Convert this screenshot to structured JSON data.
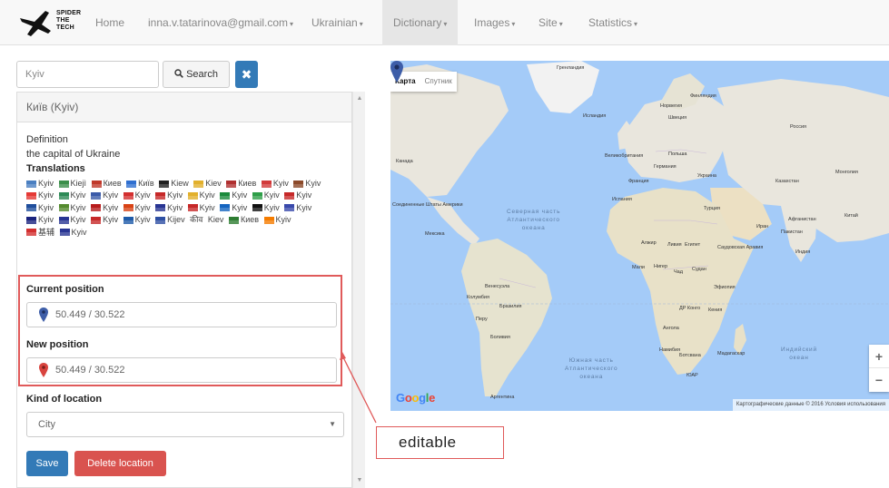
{
  "navbar": {
    "logo_text": "SPIDER\nTHE\nTECH",
    "items": [
      {
        "label": "Home",
        "caret": ""
      },
      {
        "label": "inna.v.tatarinova@gmail.com",
        "caret": "▾"
      },
      {
        "label": "Ukrainian",
        "caret": "▾"
      },
      {
        "label": "Dictionary",
        "caret": "▾"
      },
      {
        "label": "Images",
        "caret": "▾"
      },
      {
        "label": "Site",
        "caret": "▾"
      },
      {
        "label": "Statistics",
        "caret": "▾"
      }
    ]
  },
  "search": {
    "value": "Kyiv",
    "button_label": "Search",
    "clear_symbol": "✖"
  },
  "panel": {
    "heading": "Київ (Kyiv)",
    "definition_title": "Definition",
    "definition_text": "the capital of Ukraine",
    "translations_title": "Translations",
    "translations": [
      {
        "text": "Kyiv",
        "color": "#4a7fc1"
      },
      {
        "text": "Kiejì",
        "color": "#3b8f4a"
      },
      {
        "text": "Киев",
        "color": "#c0392b"
      },
      {
        "text": "Київ",
        "color": "#2f6fd0"
      },
      {
        "text": "Kiew",
        "color": "#222222"
      },
      {
        "text": "Kiev",
        "color": "#e2b02c"
      },
      {
        "text": "Киев",
        "color": "#b03030"
      },
      {
        "text": "Kyiv",
        "color": "#d23a3a"
      },
      {
        "text": "Kyiv",
        "color": "#8c4a2a"
      },
      {
        "text": "Kyiv",
        "color": "#e53935"
      },
      {
        "text": "Kyiv",
        "color": "#2e8b57"
      },
      {
        "text": "Kyiv",
        "color": "#3b5ba9"
      },
      {
        "text": "Kyiv",
        "color": "#d32f2f"
      },
      {
        "text": "Kyiv",
        "color": "#c62828"
      },
      {
        "text": "Kyiv",
        "color": "#e2b02c"
      },
      {
        "text": "Kyiv",
        "color": "#1b8a3c"
      },
      {
        "text": "Kyiv",
        "color": "#2e9e48"
      },
      {
        "text": "Kyiv",
        "color": "#c62828"
      },
      {
        "text": "Kyiv",
        "color": "#1f4e9c"
      },
      {
        "text": "Kyiv",
        "color": "#558b2f"
      },
      {
        "text": "Kyiv",
        "color": "#b71c1c"
      },
      {
        "text": "Kyiv",
        "color": "#d84315"
      },
      {
        "text": "Kyiv",
        "color": "#283593"
      },
      {
        "text": "Kyiv",
        "color": "#c62828"
      },
      {
        "text": "Kyiv",
        "color": "#1565c0"
      },
      {
        "text": "Kyiv",
        "color": "#111111"
      },
      {
        "text": "Kyiv",
        "color": "#3949ab"
      },
      {
        "text": "Kyiv",
        "color": "#1a237e"
      },
      {
        "text": "Kyiv",
        "color": "#283593"
      },
      {
        "text": "Kyiv",
        "color": "#c62828"
      },
      {
        "text": "Kyiv",
        "color": "#1e5aa8"
      },
      {
        "text": "Kijev",
        "color": "#2e4fa3"
      },
      {
        "text": "कीव",
        "color": ""
      },
      {
        "text": "Kiev",
        "color": ""
      },
      {
        "text": "Киев",
        "color": "#2e7d32"
      },
      {
        "text": "Kyiv",
        "color": "#f57c00"
      },
      {
        "text": "基辅",
        "color": "#d32f2f"
      },
      {
        "text": "Kyiv",
        "color": "#283593"
      }
    ],
    "current_position_label": "Current position",
    "current_position_value": "50.449 / 30.522",
    "new_position_label": "New position",
    "new_position_value": "50.449 / 30.522",
    "kind_label": "Kind of location",
    "kind_value": "City",
    "save_label": "Save",
    "delete_label": "Delete location"
  },
  "annotation": {
    "label": "editable"
  },
  "map": {
    "type_map": "Карта",
    "type_satellite": "Спутник",
    "google": "Google",
    "footer": "Картографические данные © 2016   Условия использования",
    "zoom_in": "+",
    "zoom_out": "−",
    "labels": [
      "Гренландия",
      "Исландия",
      "Норвегия",
      "Финляндия",
      "Швеция",
      "Великобритания",
      "Германия",
      "Польша",
      "Украина",
      "Франция",
      "Испания",
      "Казахстан",
      "Монголия",
      "Китай",
      "Турция",
      "Иран",
      "Саудовская Аравия",
      "Египет",
      "Алжир",
      "Ливия",
      "Мали",
      "Нигер",
      "Чад",
      "Судан",
      "Эфиопия",
      "Кения",
      "ДР Конго",
      "Ангола",
      "Намибия",
      "Ботсвана",
      "Мадагаскар",
      "ЮАР",
      "Бразилия",
      "Перу",
      "Венесуэла",
      "Колумбия",
      "Боливия",
      "Аргентина",
      "Канада",
      "Соединенные Штаты Америки",
      "Мексика",
      "Афганистан",
      "Пакистан",
      "Индия",
      "Россия",
      "Египет"
    ],
    "ocean_north": "Северная часть\nАтлантического\nокеана",
    "ocean_south": "Южная часть\nАтлантического\nокеана",
    "ocean_indian": "Индийский\nокеан"
  }
}
